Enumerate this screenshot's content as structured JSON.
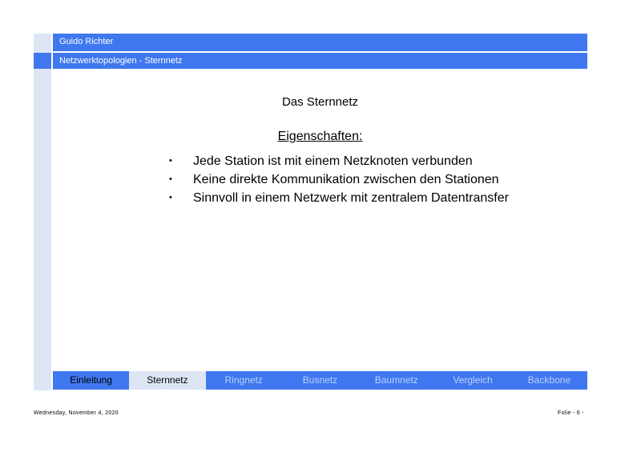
{
  "header": {
    "author": "Guido Richter",
    "section": "Netzwerktopologien - Sternnetz"
  },
  "slide": {
    "title": "Das Sternnetz",
    "subheading": "Eigenschaften:",
    "bullets": [
      {
        "marker": "•",
        "text": "Jede Station ist mit einem Netzknoten verbunden"
      },
      {
        "marker": "•",
        "text": "Keine direkte Kommunikation zwischen den Stationen"
      },
      {
        "marker": "•",
        "text": "Sinnvoll in einem Netzwerk mit zentralem Datentransfer"
      }
    ]
  },
  "nav": {
    "items": [
      {
        "label": "Einleitung"
      },
      {
        "label": "Sternnetz"
      },
      {
        "label": "Ringnetz"
      },
      {
        "label": "Busnetz"
      },
      {
        "label": "Baumnetz"
      },
      {
        "label": "Vergleich"
      },
      {
        "label": "Backbone"
      }
    ]
  },
  "footer": {
    "date": "Wednesday, November 4, 2020",
    "page": "Folie - 6 -"
  },
  "colors": {
    "accent": "#3f78ee",
    "light": "#dde5f5",
    "inactive_nav_text": "#b9d0ff"
  }
}
